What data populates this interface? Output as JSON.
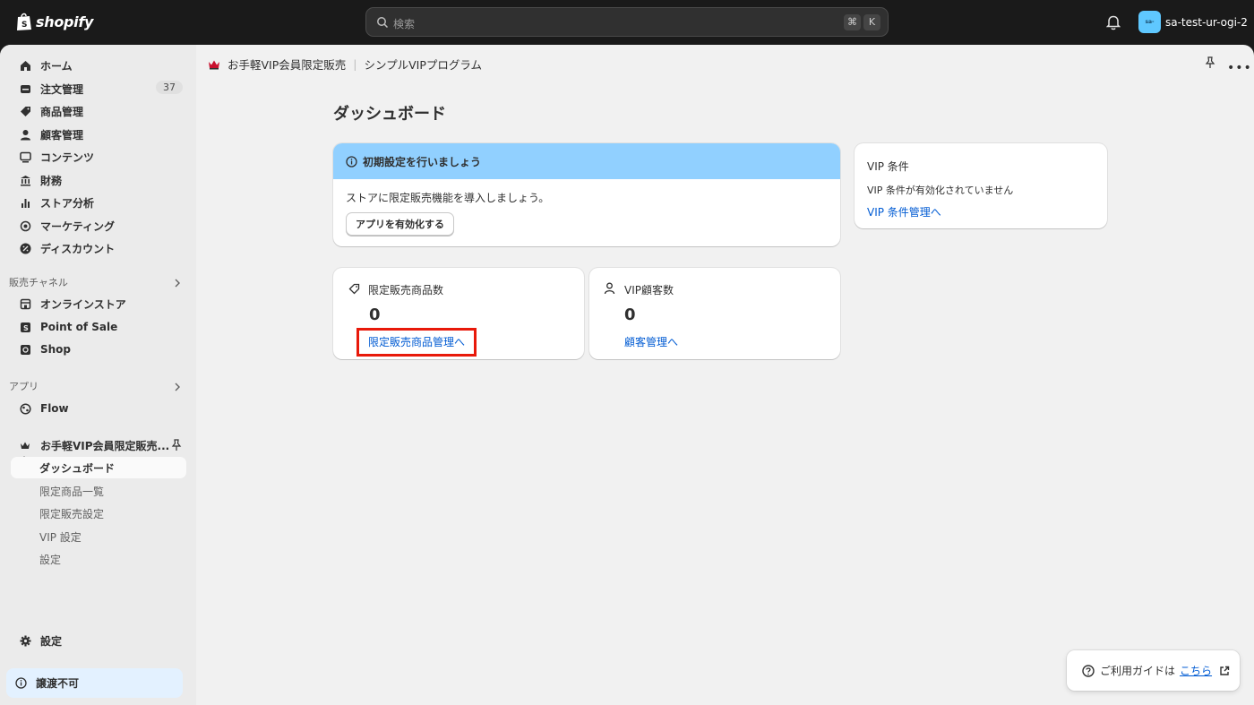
{
  "brand": {
    "wordmark": "shopify",
    "icon": "shopify-bag-icon"
  },
  "search": {
    "placeholder": "検索",
    "shortcut_cmd": "⌘",
    "shortcut_key": "K"
  },
  "store": {
    "avatar_text": "sa-",
    "name": "sa-test-ur-ogi-2"
  },
  "sidebar": {
    "items": [
      {
        "label": "ホーム",
        "icon": "home-icon"
      },
      {
        "label": "注文管理",
        "icon": "orders-icon",
        "badge": "37"
      },
      {
        "label": "商品管理",
        "icon": "tag-icon"
      },
      {
        "label": "顧客管理",
        "icon": "person-icon"
      },
      {
        "label": "コンテンツ",
        "icon": "content-icon"
      },
      {
        "label": "財務",
        "icon": "bank-icon"
      },
      {
        "label": "ストア分析",
        "icon": "analytics-icon"
      },
      {
        "label": "マーケティング",
        "icon": "target-icon"
      },
      {
        "label": "ディスカウント",
        "icon": "discount-icon"
      }
    ],
    "sales_channels_label": "販売チャネル",
    "channels": [
      {
        "label": "オンラインストア",
        "icon": "store-icon"
      },
      {
        "label": "Point of Sale",
        "icon": "pos-icon"
      },
      {
        "label": "Shop",
        "icon": "shop-icon"
      }
    ],
    "apps_label": "アプリ",
    "apps": [
      {
        "label": "Flow",
        "icon": "flow-icon"
      }
    ],
    "pinned_app": {
      "label": "お手軽VIP会員限定販売...",
      "icon": "crown-icon"
    },
    "sub_items": [
      {
        "label": "ダッシュボード",
        "active": true
      },
      {
        "label": "限定商品一覧"
      },
      {
        "label": "限定販売設定"
      },
      {
        "label": "VIP 設定"
      },
      {
        "label": "設定"
      }
    ],
    "settings_label": "設定",
    "transfer_label": "譲渡不可"
  },
  "breadcrumb": {
    "app": "お手軽VIP会員限定販売",
    "page": "シンプルVIPプログラム"
  },
  "page_title": "ダッシュボード",
  "setup_card": {
    "title": "初期設定を行いましょう",
    "body": "ストアに限定販売機能を導入しましょう。",
    "button": "アプリを有効化する"
  },
  "vip_card": {
    "title": "VIP 条件",
    "body": "VIP 条件が有効化されていません",
    "link": "VIP 条件管理へ"
  },
  "products_card": {
    "label": "限定販売商品数",
    "value": "0",
    "link": "限定販売商品管理へ"
  },
  "customers_card": {
    "label": "VIP顧客数",
    "value": "0",
    "link": "顧客管理へ"
  },
  "help": {
    "text": "ご利用ガイドは",
    "link": "こちら"
  },
  "colors": {
    "topbar": "#1a1a1a",
    "banner": "#91d0ff",
    "link": "#005bd3",
    "highlight": "#e8190a"
  }
}
